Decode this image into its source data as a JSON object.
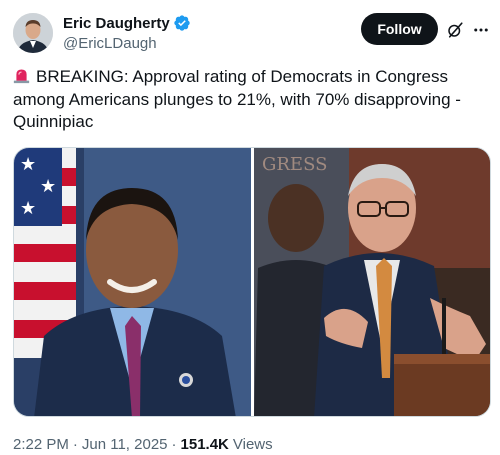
{
  "author": {
    "name": "Eric Daugherty",
    "handle": "@EricLDaugh",
    "verified": true
  },
  "actions": {
    "follow_label": "Follow",
    "grok_icon": "grok-icon",
    "more_icon": "more-icon"
  },
  "tweet": {
    "emoji": "rotating-light-icon",
    "text": "BREAKING: Approval rating of Democrats in Congress among Americans plunges to 21%, with 70% disapproving - Quinnipiac"
  },
  "meta": {
    "time": "2:22 PM",
    "dot1": "·",
    "date": "Jun 11, 2025",
    "dot2": "·",
    "views_count": "151.4K",
    "views_label": "Views"
  },
  "colors": {
    "text": "#0f1419",
    "secondary": "#536471",
    "verified": "#1d9bf0",
    "border": "#cfd9de"
  }
}
